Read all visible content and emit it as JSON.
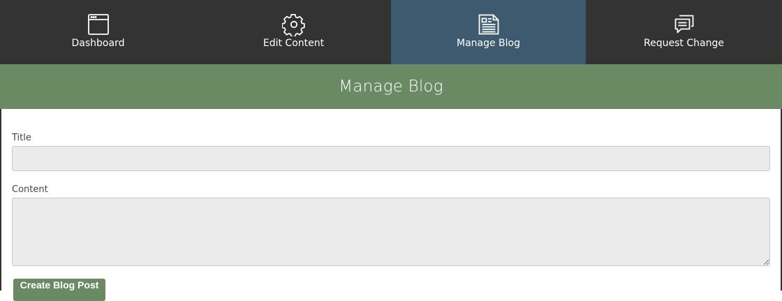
{
  "nav": {
    "items": [
      {
        "label": "Dashboard",
        "icon": "browser-window-icon",
        "active": false
      },
      {
        "label": "Edit Content",
        "icon": "gear-icon",
        "active": false
      },
      {
        "label": "Manage Blog",
        "icon": "newspaper-icon",
        "active": true
      },
      {
        "label": "Request Change",
        "icon": "chat-bubbles-icon",
        "active": false
      }
    ]
  },
  "header": {
    "title": "Manage Blog"
  },
  "form": {
    "title_label": "Title",
    "title_value": "",
    "title_placeholder": "",
    "content_label": "Content",
    "content_value": "",
    "content_placeholder": "",
    "submit_label": "Create Blog Post"
  },
  "colors": {
    "nav_bg": "#333333",
    "nav_active_bg": "#3e5a6f",
    "accent_green": "#6a8a64",
    "input_bg": "#ebebeb"
  }
}
